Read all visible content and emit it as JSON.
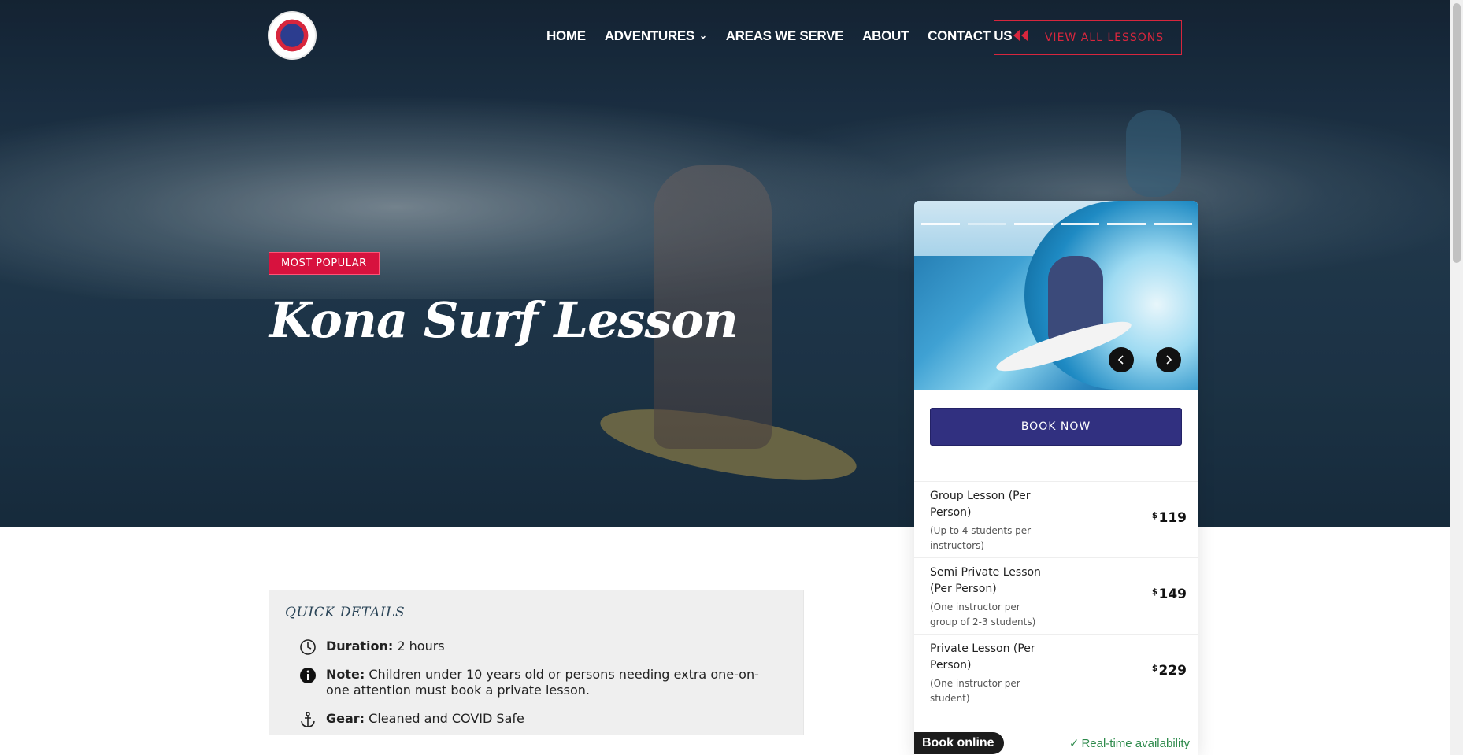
{
  "header": {
    "logo_alt": "Ocean Eco Tours",
    "nav": [
      {
        "label": "HOME"
      },
      {
        "label": "ADVENTURES"
      },
      {
        "label": "AREAS WE SERVE"
      },
      {
        "label": "ABOUT"
      },
      {
        "label": "CONTACT US"
      }
    ],
    "view_all_label": "VIEW ALL LESSONS"
  },
  "hero": {
    "badge": "MOST POPULAR",
    "title": "Kona Surf Lesson"
  },
  "booking": {
    "book_now_label": "BOOK NOW",
    "options": [
      {
        "name": "Group Lesson (Per Person)",
        "sub": "(Up to 4 students per instructors)",
        "currency": "$",
        "price": "119"
      },
      {
        "name": "Semi Private Lesson (Per Person)",
        "sub": "(One instructor per group of 2-3 students)",
        "currency": "$",
        "price": "149"
      },
      {
        "name": "Private Lesson (Per Person)",
        "sub": "(One instructor per student)",
        "currency": "$",
        "price": "229"
      }
    ],
    "book_online_label": "Book online",
    "realtime_label": "Real-time availability"
  },
  "quick_details": {
    "heading": "QUICK DETAILS",
    "items": [
      {
        "icon": "clock-icon",
        "label": "Duration:",
        "value": "2 hours"
      },
      {
        "icon": "info-icon",
        "label": "Note:",
        "value": "Children under 10 years old or persons needing extra one-on-one attention must book a private lesson."
      },
      {
        "icon": "anchor-icon",
        "label": "Gear:",
        "value": "Cleaned and COVID Safe"
      }
    ]
  },
  "colors": {
    "accent_red": "#d7123e",
    "button_navy": "#313080",
    "availability_green": "#2d8a4b"
  }
}
